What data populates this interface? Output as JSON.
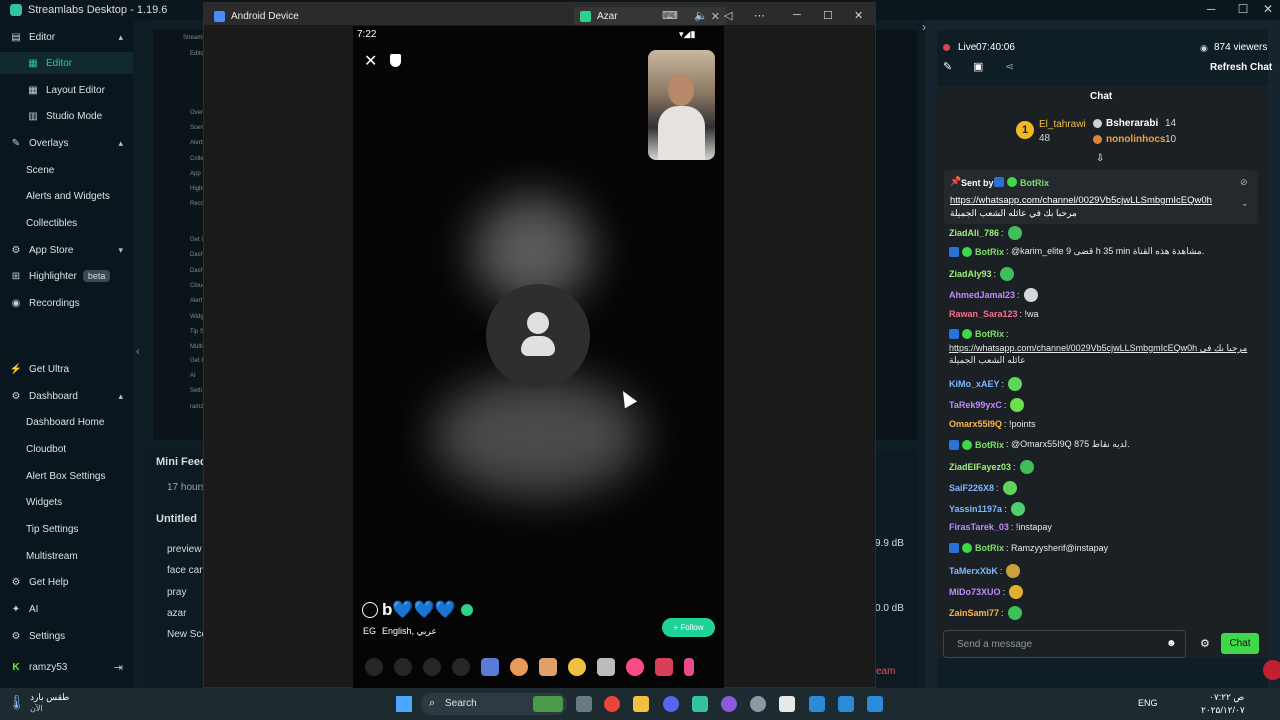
{
  "app": {
    "title": "Streamlabs Desktop - 1.19.6"
  },
  "sidebar": {
    "items": [
      {
        "label": "Editor",
        "icon": "editor-icon",
        "chev": "▴"
      },
      {
        "label": "Editor",
        "icon": "layout-icon"
      },
      {
        "label": "Layout Editor",
        "icon": "layout-editor-icon"
      },
      {
        "label": "Studio Mode",
        "icon": "studio-icon"
      },
      {
        "label": "Overlays",
        "icon": "overlays-icon",
        "chev": "▴"
      },
      {
        "label": "Scene"
      },
      {
        "label": "Alerts and Widgets"
      },
      {
        "label": "Collectibles"
      },
      {
        "label": "App Store",
        "icon": "app-store-icon",
        "chev": "▾"
      },
      {
        "label": "Highlighter",
        "icon": "highlighter-icon",
        "badge": "beta"
      },
      {
        "label": "Recordings",
        "icon": "recordings-icon"
      },
      {
        "label": "Get Ultra",
        "icon": "ultra-icon"
      },
      {
        "label": "Dashboard",
        "icon": "dashboard-icon",
        "chev": "▴"
      },
      {
        "label": "Dashboard Home"
      },
      {
        "label": "Cloudbot"
      },
      {
        "label": "Alert Box Settings"
      },
      {
        "label": "Widgets"
      },
      {
        "label": "Tip Settings"
      },
      {
        "label": "Multistream"
      },
      {
        "label": "Get Help",
        "icon": "help-icon"
      },
      {
        "label": "AI",
        "icon": "ai-icon"
      },
      {
        "label": "Settings",
        "icon": "settings-icon"
      },
      {
        "label": "ramzy53",
        "icon": "kick-icon"
      }
    ]
  },
  "editor": {
    "mini_feed": "Mini Feed",
    "hours": "17 hours",
    "untitled": "Untitled",
    "sources": [
      "preview",
      "face can",
      "pray",
      "azar",
      "New Sce"
    ],
    "db1": "9.9 dB",
    "db2": "0.0 dB",
    "team": "eam",
    "preview_labels": [
      "Streamlab",
      "Edito",
      "Overla",
      "Scen",
      "Alerts",
      "Collec",
      "App S",
      "Highl",
      "Recor",
      "Get U",
      "Dashb",
      "Dashb",
      "Cloud",
      "Alert",
      "Widg",
      "Tip S",
      "Multi",
      "Get H",
      "AI",
      "Setti",
      "ramz"
    ]
  },
  "emulator": {
    "tab1": "Android Device",
    "tab2": "Azar"
  },
  "phone": {
    "time": "7:22",
    "name": "b💙💙💙",
    "country": "EG",
    "language": "English, عربي",
    "follow": "+ Follow"
  },
  "chat": {
    "live": "Live",
    "timer": "07:40:06",
    "viewers": "874 viewers",
    "refresh": "Refresh Chat",
    "header": "Chat",
    "leaders": {
      "rank": "1",
      "first": "El_tahrawi",
      "first_count": "48",
      "second": "Bsherarabi",
      "second_count": "14",
      "third": "nonolinhocs",
      "third_count": "10"
    },
    "pinned": {
      "sent_by": "Sent by",
      "bot": "BotRix",
      "link": "https://whatsapp.com/channel/0029Vb5cjwLLSmbgmIcEQw0h",
      "text": "مرحبا بك في عائله الشعب الجميلة"
    },
    "messages": [
      {
        "user": "ZiadAli_786",
        "text": ":",
        "color": "#9ef07a",
        "emote": "#3fbf5a"
      },
      {
        "user": "BotRix",
        "text": ": @karim_elite 9 قضى h 35 min مشاهدة هذه القناة.",
        "color": "#7ee06a",
        "bot": true
      },
      {
        "user": "ZiadAly93",
        "text": ":",
        "color": "#9ef07a",
        "emote": "#3fbf5a"
      },
      {
        "user": "AhmedJamal23",
        "text": ":",
        "color": "#c08aff",
        "emote": "#d8d8d8"
      },
      {
        "user": "Rawan_Sara123",
        "text": ": !wa",
        "color": "#ff6b8a"
      },
      {
        "user": "BotRix",
        "text": ":",
        "color": "#7ee06a",
        "bot": true
      },
      {
        "user": "",
        "text": "https://whatsapp.com/channel/0029Vb5cjwLLSmbgmIcEQw0h مرحبا بك في",
        "color": "#e8eaec"
      },
      {
        "user": "",
        "text": "عائله الشعب الجميلة",
        "color": "#e8eaec"
      },
      {
        "user": "KiMo_xAEY",
        "text": ":",
        "color": "#7fb7ff",
        "emote": "#5fd45a"
      },
      {
        "user": "TaRek99yxC",
        "text": ":",
        "color": "#c08aff",
        "emote": "#6be04a"
      },
      {
        "user": "Omarx55I9Q",
        "text": ": !points",
        "color": "#ffb347"
      },
      {
        "user": "BotRix",
        "text": ": @Omarx55I9Q 875 لديه نقاط.",
        "color": "#7ee06a",
        "bot": true
      },
      {
        "user": "ZiadElFayez03",
        "text": ":",
        "color": "#9ef07a",
        "emote": "#3fbf5a"
      },
      {
        "user": "SaiF226X8",
        "text": ":",
        "color": "#7fb7ff",
        "emote": "#5fd45a"
      },
      {
        "user": "Yassin1197a",
        "text": ":",
        "color": "#7fb7ff",
        "emote": "#4fd070"
      },
      {
        "user": "FirasTarek_03",
        "text": ": !instapay",
        "color": "#c08aff"
      },
      {
        "user": "BotRix",
        "text": ": Ramzyysherif@instapay",
        "color": "#7ee06a",
        "bot": true
      },
      {
        "user": "TaMerxXbK",
        "text": ":",
        "color": "#7fb7ff",
        "emote": "#c9a13a"
      },
      {
        "user": "MiDo73XUO",
        "text": ":",
        "color": "#c08aff",
        "emote": "#e0b030"
      },
      {
        "user": "ZainSami77",
        "text": ":",
        "color": "#ffb347",
        "emote": "#3fbf5a"
      }
    ],
    "input_placeholder": "Send a message",
    "send": "Chat"
  },
  "taskbar": {
    "weather": "طقس بارد",
    "weather_sub": "الآن",
    "search": "Search",
    "lang": "ENG",
    "time": "۰۷:۲۲ ص",
    "date": "۲۰۲۵/۱۲/۰۷"
  },
  "colors": {
    "accent": "#31c3a2",
    "chat_btn": "#3fd84a",
    "follow": "#1fd29a"
  }
}
